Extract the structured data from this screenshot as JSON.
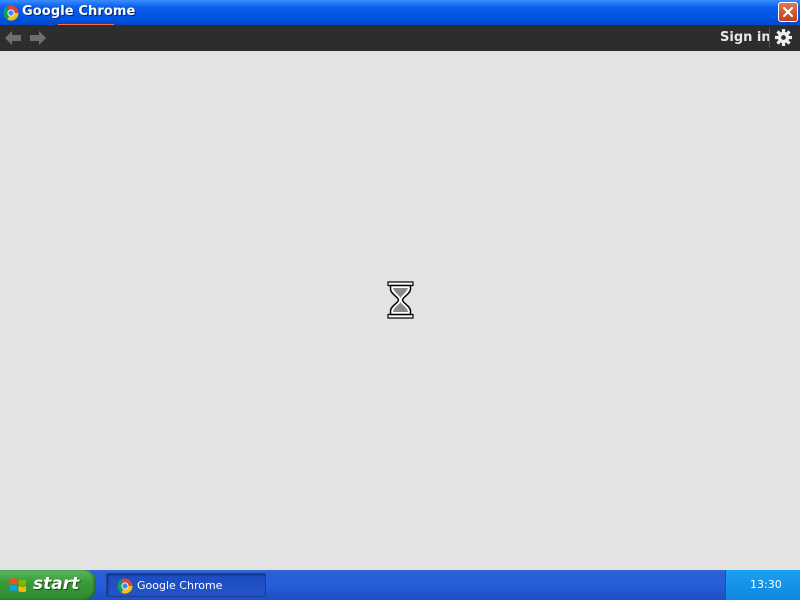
{
  "window": {
    "title": "Google Chrome"
  },
  "toolbar": {
    "back_icon": "back-arrow-icon",
    "forward_icon": "forward-arrow-icon",
    "sign_in_label": "Sign in",
    "settings_icon": "gear-icon"
  },
  "content": {
    "status_icon": "hourglass-icon"
  },
  "taskbar": {
    "start_label": "start",
    "items": [
      {
        "label": "Google Chrome",
        "icon": "chrome-icon"
      }
    ],
    "clock": "13:30"
  },
  "colors": {
    "titlebar": "#0054e3",
    "toolbar": "#2d2d2d",
    "content_bg": "#e3e3e3",
    "taskbar": "#245edb",
    "start_button": "#3a9b3a",
    "tray": "#0f87e0"
  }
}
